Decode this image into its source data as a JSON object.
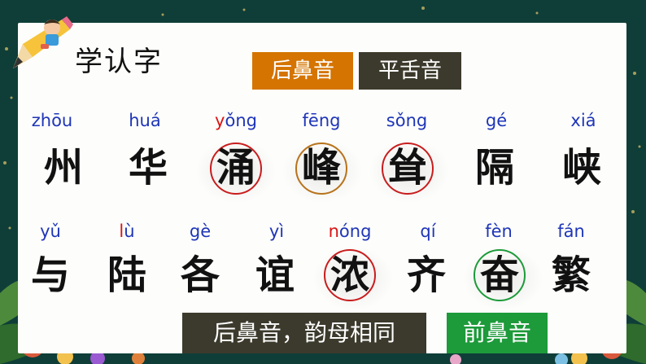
{
  "title": "学认字",
  "tags": {
    "back_nasal": "后鼻音",
    "flat_tongue": "平舌音",
    "back_nasal_same": "后鼻音，韵母相同",
    "front_nasal": "前鼻音"
  },
  "row1": [
    {
      "py_pre": "",
      "py_hl": "",
      "py_post": "zhōu",
      "hz": "州"
    },
    {
      "py_pre": "",
      "py_hl": "",
      "py_post": "huá",
      "hz": "华"
    },
    {
      "py_pre": "",
      "py_hl": "y",
      "py_post": "ǒng",
      "hz": "涌"
    },
    {
      "py_pre": "",
      "py_hl": "",
      "py_post": "fēng",
      "hz": "峰"
    },
    {
      "py_pre": "",
      "py_hl": "",
      "py_post": "sǒng",
      "hz": "耸"
    },
    {
      "py_pre": "",
      "py_hl": "",
      "py_post": "gé",
      "hz": "隔"
    },
    {
      "py_pre": "",
      "py_hl": "",
      "py_post": "xiá",
      "hz": "峡"
    }
  ],
  "row2": [
    {
      "py_pre": "",
      "py_hl": "",
      "py_post": "yǔ",
      "hz": "与"
    },
    {
      "py_pre": "",
      "py_hl": "l",
      "py_post": "ù",
      "hz": "陆"
    },
    {
      "py_pre": "",
      "py_hl": "",
      "py_post": "gè",
      "hz": "各"
    },
    {
      "py_pre": "",
      "py_hl": "",
      "py_post": "yì",
      "hz": "谊"
    },
    {
      "py_pre": "",
      "py_hl": "n",
      "py_post": "óng",
      "hz": "浓"
    },
    {
      "py_pre": "",
      "py_hl": "",
      "py_post": "qí",
      "hz": "齐"
    },
    {
      "py_pre": "",
      "py_hl": "",
      "py_post": "fèn",
      "hz": "奋"
    },
    {
      "py_pre": "",
      "py_hl": "",
      "py_post": "fán",
      "hz": "繁"
    }
  ]
}
